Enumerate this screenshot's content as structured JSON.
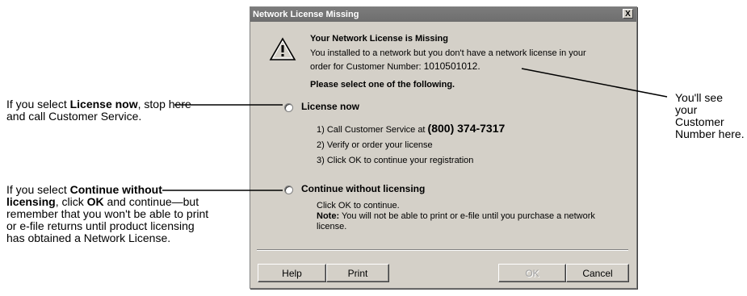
{
  "dialog": {
    "title": "Network License Missing",
    "close_glyph": "X",
    "header_title": "Your Network License is Missing",
    "header_line1": "You installed to a network but you don't have a network license in your",
    "header_line2_prefix": "order for Customer Number: ",
    "customer_number": "1010501012.",
    "select_prompt": "Please select one of the following.",
    "option1_label": "License now",
    "option1_step1_prefix": "1) Call Customer Service at ",
    "option1_phone": "(800) 374-7317",
    "option1_step2": "2) Verify or order your license",
    "option1_step3": "3) Click OK to continue your registration",
    "option2_label": "Continue without licensing",
    "option2_line1": "Click OK to continue.",
    "option2_note_label": "Note:",
    "option2_note_text": "  You will not be able to print or e-file until you purchase a network license.",
    "buttons": {
      "help": "Help",
      "print": "Print",
      "ok": "OK",
      "cancel": "Cancel"
    },
    "warning_icon": "warning-triangle-icon"
  },
  "callouts": {
    "left1_pre": "If you select ",
    "left1_bold": "License now",
    "left1_post": ", stop here and call Customer Service.",
    "left2_pre": "If you select ",
    "left2_bold1": "Continue without licensing",
    "left2_mid": ", click ",
    "left2_bold2": "OK",
    "left2_post": " and continue—but remember that you won't be able to print or e-file returns until product licensing has obtained a Network License.",
    "right": "You'll see your Customer Number here."
  }
}
